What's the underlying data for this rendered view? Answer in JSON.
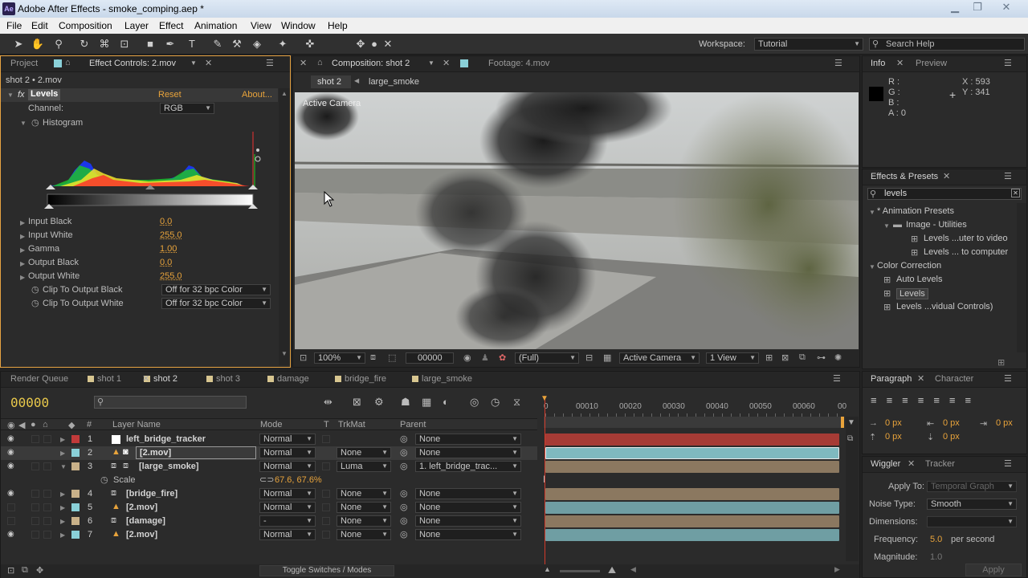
{
  "window": {
    "title": "Adobe After Effects - smoke_comping.aep *",
    "icon": "Ae"
  },
  "menu": [
    "File",
    "Edit",
    "Composition",
    "Layer",
    "Effect",
    "Animation",
    "View",
    "Window",
    "Help"
  ],
  "toolbar": {
    "workspace_label": "Workspace:",
    "workspace_value": "Tutorial",
    "search_placeholder": "Search Help"
  },
  "left_panel": {
    "tabs": [
      "Project",
      "Effect Controls: 2.mov"
    ],
    "breadcrumb": "shot 2 • 2.mov",
    "effect": {
      "name": "Levels",
      "reset": "Reset",
      "about": "About...",
      "channel_label": "Channel:",
      "channel_value": "RGB",
      "histogram_label": "Histogram"
    },
    "props": [
      {
        "name": "Input Black",
        "value": "0.0"
      },
      {
        "name": "Input White",
        "value": "255.0"
      },
      {
        "name": "Gamma",
        "value": "1.00"
      },
      {
        "name": "Output Black",
        "value": "0.0"
      },
      {
        "name": "Output White",
        "value": "255.0"
      }
    ],
    "clips": [
      {
        "name": "Clip To Output Black",
        "value": "Off for 32 bpc Color"
      },
      {
        "name": "Clip To Output White",
        "value": "Off for 32 bpc Color"
      }
    ]
  },
  "viewer": {
    "tabs": [
      "Composition: shot 2",
      "Footage: 4.mov"
    ],
    "breadcrumbs": [
      "shot 2",
      "large_smoke"
    ],
    "overlay": "Active Camera",
    "bottom": {
      "zoom": "100%",
      "timecode": "00000",
      "resolution": "(Full)",
      "camera": "Active Camera",
      "views": "1 View"
    }
  },
  "info_panel": {
    "tabs": [
      "Info",
      "Preview"
    ],
    "r": "R :",
    "g": "G :",
    "b": "B :",
    "a": "A : 0",
    "x": "X : 593",
    "y": "Y : 341"
  },
  "effects_presets": {
    "title": "Effects & Presets",
    "search": "levels",
    "tree": [
      {
        "label": "* Animation Presets",
        "level": 0,
        "type": "folder"
      },
      {
        "label": "Image - Utilities",
        "level": 1,
        "type": "folder"
      },
      {
        "label": "Levels ...uter to video",
        "level": 2,
        "type": "preset"
      },
      {
        "label": "Levels ... to computer",
        "level": 2,
        "type": "preset"
      },
      {
        "label": "Color Correction",
        "level": 0,
        "type": "folder"
      },
      {
        "label": "Auto Levels",
        "level": 1,
        "type": "effect"
      },
      {
        "label": "Levels",
        "level": 1,
        "type": "effect",
        "selected": true
      },
      {
        "label": "Levels ...vidual Controls)",
        "level": 1,
        "type": "effect"
      }
    ]
  },
  "timeline": {
    "tabs": [
      "Render Queue",
      "shot 1",
      "shot 2",
      "shot 3",
      "damage",
      "bridge_fire",
      "large_smoke"
    ],
    "tab_colors": [
      "",
      "#d8c690",
      "#d8c690",
      "#d8c690",
      "#d8c690",
      "#d8c690",
      "#d8c690"
    ],
    "timecode": "00000",
    "columns": {
      "num": "#",
      "layer_name": "Layer Name",
      "mode": "Mode",
      "t": "T",
      "trkmat": "TrkMat",
      "parent": "Parent"
    },
    "ruler": [
      "0",
      "00010",
      "00020",
      "00030",
      "00040",
      "00050",
      "00060",
      "00"
    ],
    "layers": [
      {
        "num": "1",
        "name": "left_bridge_tracker",
        "color": "#c03a3a",
        "mode": "Normal",
        "trkmat": "",
        "parent": "None",
        "bar": "#a63b35",
        "icon": "solid"
      },
      {
        "num": "2",
        "name": "[2.mov]",
        "color": "#8ad0d8",
        "mode": "Normal",
        "trkmat": "None",
        "parent": "None",
        "bar": "#7fb9bf",
        "icon": "footage",
        "selected": true
      },
      {
        "num": "3",
        "name": "[large_smoke]",
        "color": "#c9b189",
        "mode": "Normal",
        "trkmat": "Luma",
        "parent": "1. left_bridge_trac...",
        "bar": "#8b7860",
        "icon": "comp",
        "expanded": true
      },
      {
        "num": "4",
        "name": "[bridge_fire]",
        "color": "#c9b189",
        "mode": "Normal",
        "trkmat": "None",
        "parent": "None",
        "bar": "#8b7860",
        "icon": "comp"
      },
      {
        "num": "5",
        "name": "[2.mov]",
        "color": "#8ad0d8",
        "mode": "Normal",
        "trkmat": "None",
        "parent": "None",
        "bar": "#6f9ea3",
        "icon": "footage"
      },
      {
        "num": "6",
        "name": "[damage]",
        "color": "#c9b189",
        "mode": "-",
        "trkmat": "None",
        "parent": "None",
        "bar": "#8b7860",
        "icon": "comp"
      },
      {
        "num": "7",
        "name": "[2.mov]",
        "color": "#8ad0d8",
        "mode": "Normal",
        "trkmat": "None",
        "parent": "None",
        "bar": "#6f9ea3",
        "icon": "footage"
      }
    ],
    "sub_prop": {
      "name": "Scale",
      "value": "67.6, 67.6%"
    },
    "toggle": "Toggle Switches / Modes"
  },
  "paragraph": {
    "tabs": [
      "Paragraph",
      "Character"
    ],
    "values": [
      "0 px",
      "0 px",
      "0 px",
      "0 px",
      "0 px"
    ]
  },
  "wiggler": {
    "tabs": [
      "Wiggler",
      "Tracker"
    ],
    "apply_to_label": "Apply To:",
    "apply_to_value": "Temporal Graph",
    "noise_label": "Noise Type:",
    "noise_value": "Smooth",
    "dimensions_label": "Dimensions:",
    "frequency_label": "Frequency:",
    "frequency_value": "5.0",
    "frequency_unit": "per second",
    "magnitude_label": "Magnitude:",
    "magnitude_value": "1.0",
    "apply_button": "Apply"
  }
}
